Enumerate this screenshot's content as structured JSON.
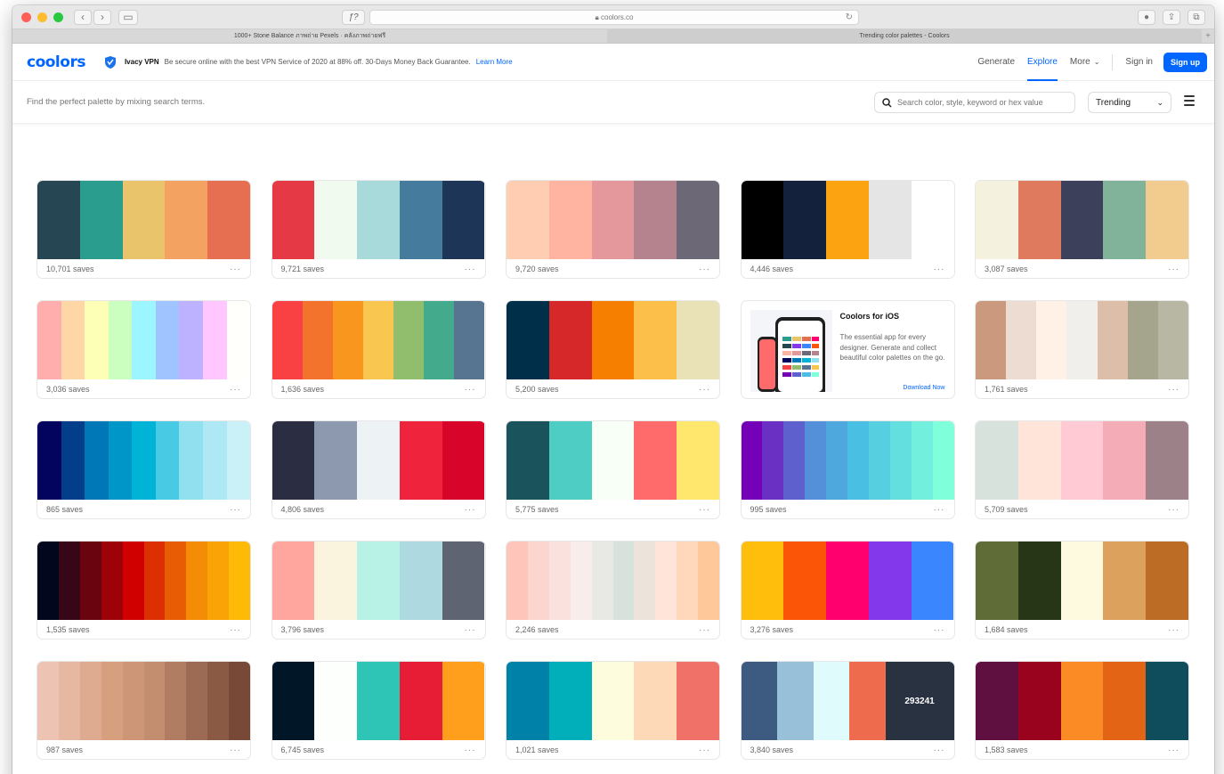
{
  "browser": {
    "url": "coolors.co",
    "tabs": [
      {
        "label": "1000+ Stone Balance ภาพถ่าย Pexels · คลังภาพถ่ายฟรี",
        "active": false
      },
      {
        "label": "Trending color palettes - Coolors",
        "active": true
      }
    ],
    "f_label": "ƒ?"
  },
  "header": {
    "logo": "coolors",
    "ad": {
      "brand": "Ivacy VPN",
      "text": "Be secure online with the best VPN Service of 2020 at 88% off. 30-Days Money Back Guarantee.",
      "link": "Learn More"
    },
    "nav": {
      "generate": "Generate",
      "explore": "Explore",
      "more": "More",
      "signin": "Sign in",
      "signup": "Sign up"
    }
  },
  "search": {
    "hint": "Find the perfect palette by mixing search terms.",
    "placeholder": "Search color, style, keyword or hex value",
    "sort": "Trending"
  },
  "promo": {
    "title": "Coolors for iOS",
    "text": "The essential app for every designer. Generate and collect beautiful color palettes on the go.",
    "link": "Download Now"
  },
  "palettes": [
    {
      "saves": "10,701 saves",
      "colors": [
        "#264653",
        "#2a9d8f",
        "#e9c46a",
        "#f4a261",
        "#e76f51"
      ]
    },
    {
      "saves": "9,721 saves",
      "colors": [
        "#e63946",
        "#f1faee",
        "#a8dadc",
        "#457b9d",
        "#1d3557"
      ]
    },
    {
      "saves": "9,720 saves",
      "colors": [
        "#ffcdb2",
        "#ffb4a2",
        "#e5989b",
        "#b5838d",
        "#6d6875"
      ]
    },
    {
      "saves": "4,446 saves",
      "colors": [
        "#000000",
        "#14213d",
        "#fca311",
        "#e5e5e5",
        "#ffffff"
      ]
    },
    {
      "saves": "3,087 saves",
      "colors": [
        "#f4f1de",
        "#e07a5f",
        "#3d405b",
        "#81b29a",
        "#f2cc8f"
      ]
    },
    {
      "saves": "3,036 saves",
      "colors": [
        "#ffadad",
        "#ffd6a5",
        "#fdffb6",
        "#caffbf",
        "#9bf6ff",
        "#a0c4ff",
        "#bdb2ff",
        "#ffc6ff",
        "#fffffc"
      ]
    },
    {
      "saves": "1,636 saves",
      "colors": [
        "#f94144",
        "#f3722c",
        "#f8961e",
        "#f9c74f",
        "#90be6d",
        "#43aa8b",
        "#577590"
      ]
    },
    {
      "saves": "5,200 saves",
      "colors": [
        "#003049",
        "#d62828",
        "#f77f00",
        "#fcbf49",
        "#eae2b7"
      ]
    },
    {
      "promo": true
    },
    {
      "saves": "1,761 saves",
      "colors": [
        "#cb997e",
        "#eddcd2",
        "#fff1e6",
        "#f0efeb",
        "#ddbea9",
        "#a5a58d",
        "#b7b7a4"
      ]
    },
    {
      "saves": "865 saves",
      "colors": [
        "#03045e",
        "#023e8a",
        "#0077b6",
        "#0096c7",
        "#00b4d8",
        "#48cae4",
        "#90e0ef",
        "#ade8f4",
        "#caf0f8"
      ]
    },
    {
      "saves": "4,806 saves",
      "colors": [
        "#2b2d42",
        "#8d99ae",
        "#edf2f4",
        "#ef233c",
        "#d90429"
      ]
    },
    {
      "saves": "5,775 saves",
      "colors": [
        "#1a535c",
        "#4ecdc4",
        "#f7fff7",
        "#ff6b6b",
        "#ffe66d"
      ]
    },
    {
      "saves": "995 saves",
      "colors": [
        "#7400b8",
        "#6930c3",
        "#5e60ce",
        "#5390d9",
        "#4ea8de",
        "#48bfe3",
        "#56cfe1",
        "#64dfdf",
        "#72efdd",
        "#80ffdb"
      ]
    },
    {
      "saves": "5,709 saves",
      "colors": [
        "#d8e2dc",
        "#ffe5d9",
        "#ffcad4",
        "#f4acb7",
        "#9d8189"
      ]
    },
    {
      "saves": "1,535 saves",
      "colors": [
        "#03071e",
        "#370617",
        "#6a040f",
        "#9d0208",
        "#d00000",
        "#dc2f02",
        "#e85d04",
        "#f48c06",
        "#faa307",
        "#ffba08"
      ]
    },
    {
      "saves": "3,796 saves",
      "colors": [
        "#ffa69e",
        "#faf3dd",
        "#b8f2e6",
        "#aed9e0",
        "#5e6472"
      ]
    },
    {
      "saves": "2,246 saves",
      "colors": [
        "#fec5bb",
        "#fcd5ce",
        "#fae1dd",
        "#f8edeb",
        "#e8e8e4",
        "#d8e2dc",
        "#ece4db",
        "#ffe5d9",
        "#ffd7ba",
        "#fec89a"
      ]
    },
    {
      "saves": "3,276 saves",
      "colors": [
        "#ffbe0b",
        "#fb5607",
        "#ff006e",
        "#8338ec",
        "#3a86ff"
      ]
    },
    {
      "saves": "1,684 saves",
      "colors": [
        "#606c38",
        "#283618",
        "#fefae0",
        "#dda15e",
        "#bc6c25"
      ]
    },
    {
      "saves": "987 saves",
      "colors": [
        "#edc4b3",
        "#e6b8a2",
        "#deab90",
        "#d69f7e",
        "#cd9777",
        "#c38e70",
        "#b07d62",
        "#9d6b53",
        "#8a5a44",
        "#774936"
      ]
    },
    {
      "saves": "6,745 saves",
      "colors": [
        "#011627",
        "#fdfffc",
        "#2ec4b6",
        "#e71d36",
        "#ff9f1c"
      ]
    },
    {
      "saves": "1,021 saves",
      "colors": [
        "#0081a7",
        "#00afb9",
        "#fdfcdc",
        "#fed9b7",
        "#f07167"
      ]
    },
    {
      "saves": "3,840 saves",
      "colors": [
        "#3d5a80",
        "#98c1d9",
        "#e0fbfc",
        "#ee6c4d",
        "#293241"
      ],
      "hover_label": "293241"
    },
    {
      "saves": "1,583 saves",
      "colors": [
        "#5f0f40",
        "#9a031e",
        "#fb8b24",
        "#e36414",
        "#0f4c5c"
      ]
    }
  ]
}
